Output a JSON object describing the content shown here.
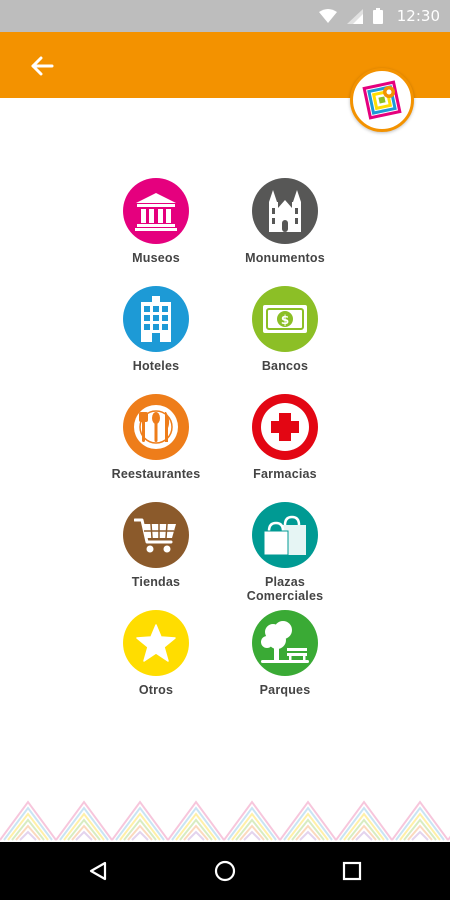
{
  "status_bar": {
    "time": "12:30",
    "icons": [
      "wifi-icon",
      "signal-icon",
      "battery-icon"
    ],
    "background": "#bdbdbd"
  },
  "app_bar": {
    "background": "#f39200",
    "back_icon": "arrow-left-icon",
    "logo_icon": "app-logo-icon"
  },
  "categories": [
    {
      "label": "Museos",
      "icon": "museum-icon",
      "color": "#e5007e"
    },
    {
      "label": "Monumentos",
      "icon": "cathedral-icon",
      "color": "#575756"
    },
    {
      "label": "Hoteles",
      "icon": "hotel-icon",
      "color": "#1d9ad6"
    },
    {
      "label": "Bancos",
      "icon": "banknote-icon",
      "color": "#8cbf26"
    },
    {
      "label": "Reestaurantes",
      "icon": "cutlery-icon",
      "color": "#ee7d1a"
    },
    {
      "label": "Farmacias",
      "icon": "pharmacy-cross-icon",
      "color": "#e30613"
    },
    {
      "label": "Tiendas",
      "icon": "shopping-cart-icon",
      "color": "#8b5a2b"
    },
    {
      "label": "Plazas\nComerciales",
      "label_line1": "Plazas",
      "label_line2": "Comerciales",
      "icon": "shopping-bags-icon",
      "color": "#009a93"
    },
    {
      "label": "Otros",
      "icon": "star-icon",
      "color": "#ffdd00"
    },
    {
      "label": "Parques",
      "icon": "park-tree-icon",
      "color": "#3aaa35"
    }
  ],
  "nav_bar": {
    "buttons": [
      "back-triangle-icon",
      "home-circle-icon",
      "recents-square-icon"
    ]
  }
}
